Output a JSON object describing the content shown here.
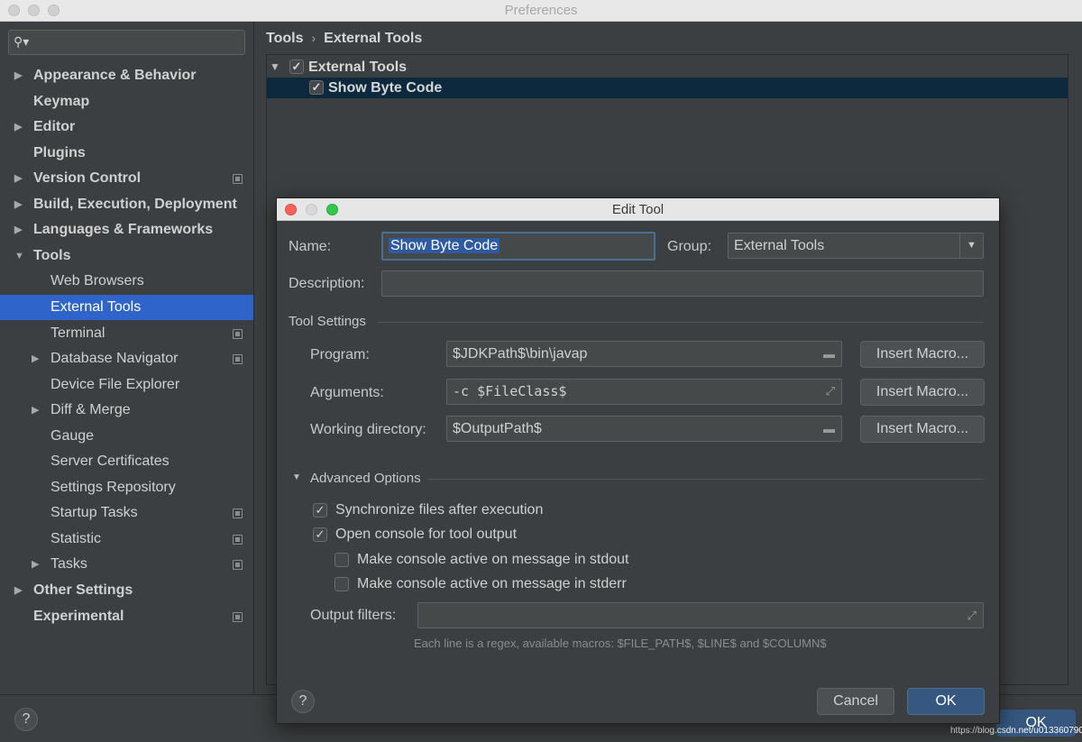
{
  "window": {
    "title": "Preferences"
  },
  "sidebar": {
    "items": [
      {
        "label": "Appearance & Behavior",
        "level": 0,
        "expander": "right",
        "bold": true
      },
      {
        "label": "Keymap",
        "level": 0,
        "expander": "",
        "bold": true
      },
      {
        "label": "Editor",
        "level": 0,
        "expander": "right",
        "bold": true
      },
      {
        "label": "Plugins",
        "level": 0,
        "expander": "",
        "bold": true
      },
      {
        "label": "Version Control",
        "level": 0,
        "expander": "right",
        "bold": true,
        "project": true
      },
      {
        "label": "Build, Execution, Deployment",
        "level": 0,
        "expander": "right",
        "bold": true
      },
      {
        "label": "Languages & Frameworks",
        "level": 0,
        "expander": "right",
        "bold": true
      },
      {
        "label": "Tools",
        "level": 0,
        "expander": "down",
        "bold": true
      },
      {
        "label": "Web Browsers",
        "level": 1,
        "expander": ""
      },
      {
        "label": "External Tools",
        "level": 1,
        "expander": "",
        "selected": true
      },
      {
        "label": "Terminal",
        "level": 1,
        "expander": "",
        "project": true
      },
      {
        "label": "Database Navigator",
        "level": 1,
        "expander": "right",
        "project": true
      },
      {
        "label": "Device File Explorer",
        "level": 1,
        "expander": ""
      },
      {
        "label": "Diff & Merge",
        "level": 1,
        "expander": "right"
      },
      {
        "label": "Gauge",
        "level": 1,
        "expander": ""
      },
      {
        "label": "Server Certificates",
        "level": 1,
        "expander": ""
      },
      {
        "label": "Settings Repository",
        "level": 1,
        "expander": ""
      },
      {
        "label": "Startup Tasks",
        "level": 1,
        "expander": "",
        "project": true
      },
      {
        "label": "Statistic",
        "level": 1,
        "expander": "",
        "project": true
      },
      {
        "label": "Tasks",
        "level": 1,
        "expander": "right",
        "project": true
      },
      {
        "label": "Other Settings",
        "level": 0,
        "expander": "right",
        "bold": true
      },
      {
        "label": "Experimental",
        "level": 0,
        "expander": "",
        "bold": true,
        "project": true
      }
    ]
  },
  "breadcrumb": {
    "root": "Tools",
    "current": "External Tools"
  },
  "tool_tree": {
    "group_label": "External Tools",
    "group_checked": true,
    "item_label": "Show Byte Code",
    "item_checked": true
  },
  "dialog": {
    "title": "Edit Tool",
    "name_label": "Name:",
    "name_value": "Show Byte Code",
    "group_label": "Group:",
    "group_value": "External Tools",
    "description_label": "Description:",
    "description_value": "",
    "tool_settings_label": "Tool Settings",
    "program_label": "Program:",
    "program_value": "$JDKPath$\\bin\\javap",
    "arguments_label": "Arguments:",
    "arguments_value": "-c $FileClass$",
    "working_dir_label": "Working directory:",
    "working_dir_value": "$OutputPath$",
    "insert_macro_label": "Insert Macro...",
    "advanced_label": "Advanced Options",
    "options": [
      {
        "label": "Synchronize files after execution",
        "checked": true,
        "indent": 0
      },
      {
        "label": "Open console for tool output",
        "checked": true,
        "indent": 0
      },
      {
        "label": "Make console active on message in stdout",
        "checked": false,
        "indent": 1
      },
      {
        "label": "Make console active on message in stderr",
        "checked": false,
        "indent": 1
      }
    ],
    "output_filters_label": "Output filters:",
    "output_filters_value": "",
    "hint": "Each line is a regex, available macros: $FILE_PATH$, $LINE$ and $COLUMN$",
    "cancel_label": "Cancel",
    "ok_label": "OK",
    "help_label": "?"
  },
  "footer": {
    "help_label": "?",
    "ok_label": "OK",
    "watermark": "https://blog.csdn.net/u013360790"
  }
}
